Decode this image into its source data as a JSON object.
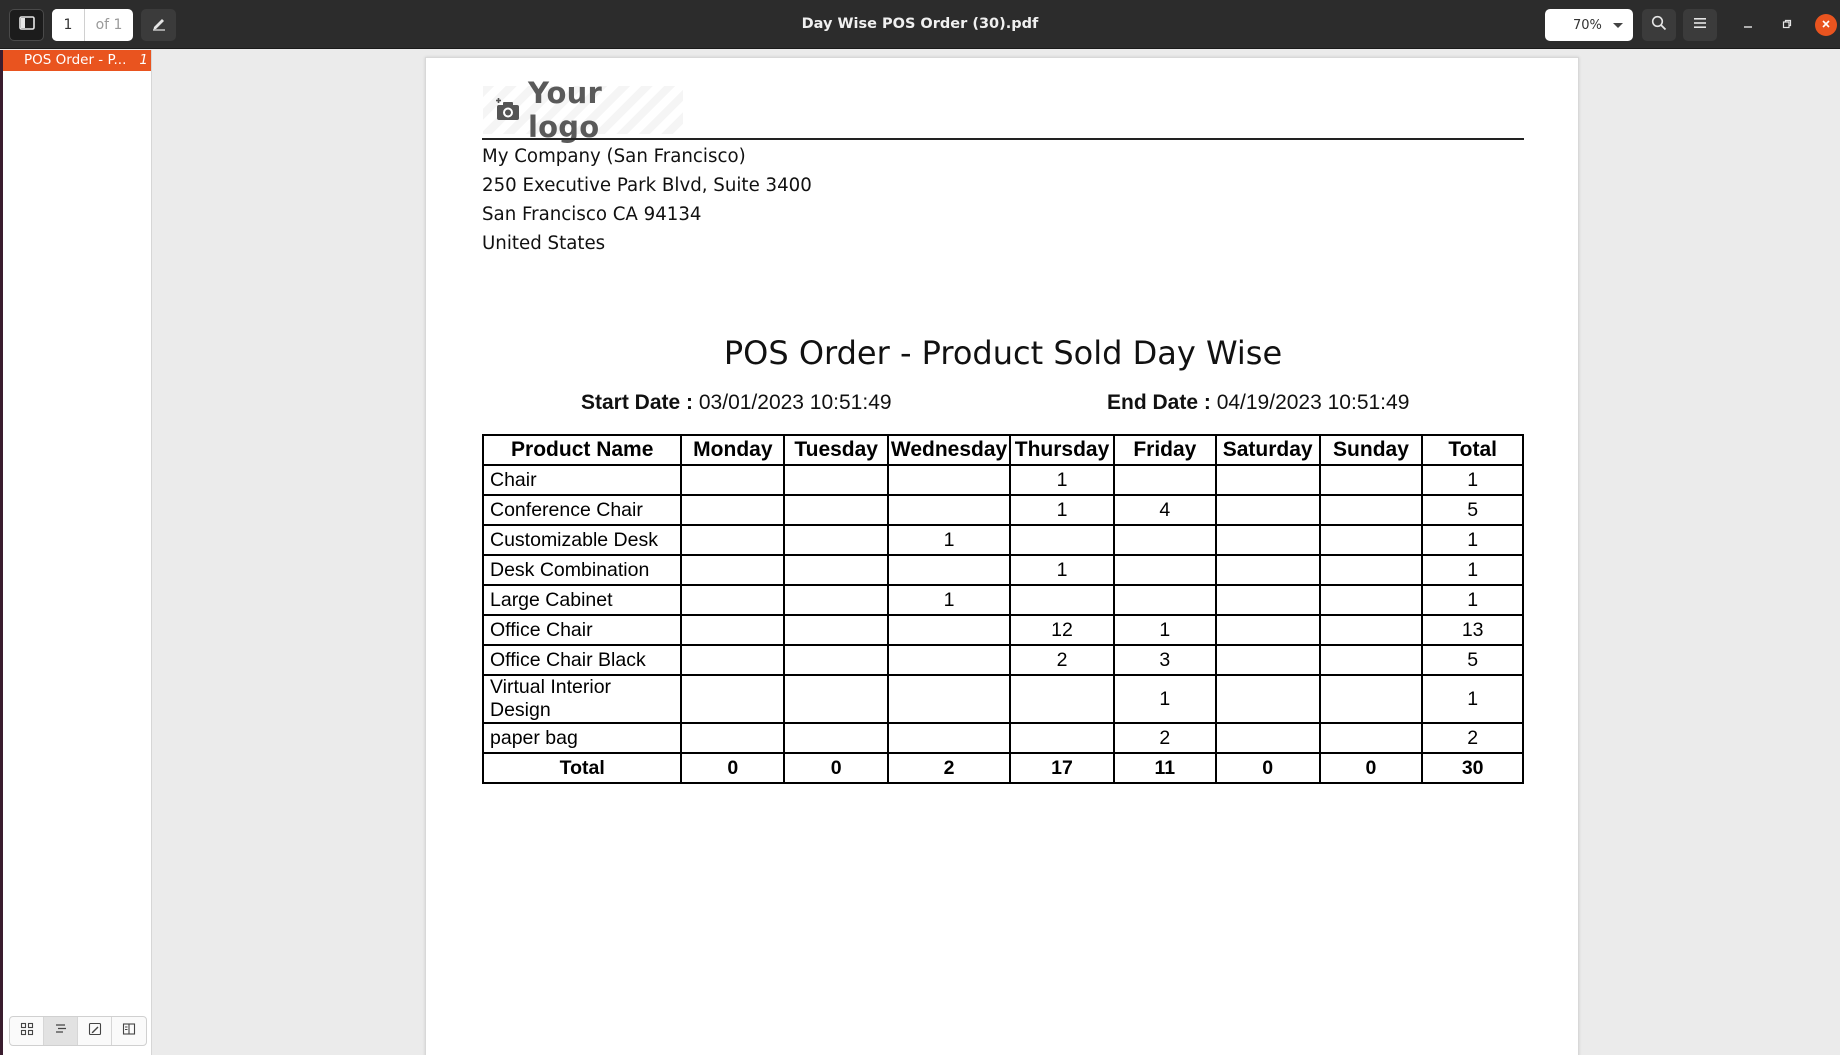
{
  "header": {
    "page_current": "1",
    "page_of": "of 1",
    "title": "Day Wise POS Order (30).pdf",
    "zoom": "70%"
  },
  "sidebar": {
    "outline_label": "POS Order - P...",
    "outline_page": "1",
    "tabs": [
      "thumbnails-icon",
      "outline-icon",
      "annotations-icon",
      "layers-icon"
    ]
  },
  "document": {
    "logo_text": "Your logo",
    "company": "My Company (San Francisco)",
    "address_line1": "250 Executive Park Blvd, Suite 3400",
    "address_line2": "San Francisco CA 94134",
    "country": "United States",
    "report_title": "POS Order - Product Sold Day Wise",
    "start_label": "Start Date :",
    "start_value": "03/01/2023 10:51:49",
    "end_label": "End Date :",
    "end_value": "04/19/2023 10:51:49",
    "table": {
      "headers": [
        "Product Name",
        "Monday",
        "Tuesday",
        "Wednesday",
        "Thursday",
        "Friday",
        "Saturday",
        "Sunday",
        "Total"
      ],
      "rows": [
        [
          "Chair",
          "",
          "",
          "",
          "1",
          "",
          "",
          "",
          "1"
        ],
        [
          "Conference Chair",
          "",
          "",
          "",
          "1",
          "4",
          "",
          "",
          "5"
        ],
        [
          "Customizable Desk",
          "",
          "",
          "1",
          "",
          "",
          "",
          "",
          "1"
        ],
        [
          "Desk Combination",
          "",
          "",
          "",
          "1",
          "",
          "",
          "",
          "1"
        ],
        [
          "Large Cabinet",
          "",
          "",
          "1",
          "",
          "",
          "",
          "",
          "1"
        ],
        [
          "Office Chair",
          "",
          "",
          "",
          "12",
          "1",
          "",
          "",
          "13"
        ],
        [
          "Office Chair Black",
          "",
          "",
          "",
          "2",
          "3",
          "",
          "",
          "5"
        ],
        [
          "Virtual Interior Design",
          "",
          "",
          "",
          "",
          "1",
          "",
          "",
          "1"
        ],
        [
          "paper bag",
          "",
          "",
          "",
          "",
          "2",
          "",
          "",
          "2"
        ]
      ],
      "totals": [
        "Total",
        "0",
        "0",
        "2",
        "17",
        "11",
        "0",
        "0",
        "30"
      ]
    }
  },
  "colors": {
    "accent": "#e9541f",
    "headerbar": "#2c2c2c"
  }
}
